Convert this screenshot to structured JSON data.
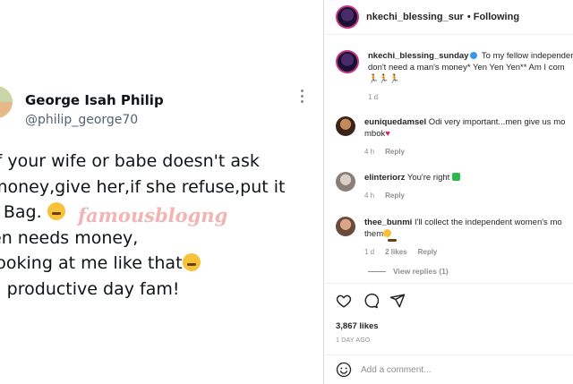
{
  "tweet": {
    "name": "George Isah Philip",
    "handle": "@philip_george70",
    "lines": [
      "If your wife or babe doesn't ask",
      "money,give her,if she refuse,put it",
      "r Bag.",
      "en needs money,",
      "looking at me like that",
      "a productive day fam!"
    ],
    "watermark": "famousblogng"
  },
  "header": {
    "username": "nkechi_blessing_sur",
    "follow_label": "• Following"
  },
  "caption": {
    "username": "nkechi_blessing_sunday",
    "text_1": " To my fellow independent",
    "text_2": "don't need a man's money* Yen Yen Yen** Am I com",
    "text_3": "🏃🏃🏃",
    "time": "1 d"
  },
  "comments": [
    {
      "username": "euniquedamsel",
      "text": " Odi very important...men give us mo",
      "text_2": "mbok",
      "time": "4 h",
      "reply": "Reply"
    },
    {
      "username": "elinteriorz",
      "text": " You're right ",
      "time": "4 h",
      "reply": "Reply"
    },
    {
      "username": "thee_bunmi",
      "text": " I'll collect the independent women's mo",
      "text_2": "them",
      "time": "1 d",
      "likes": "2 likes",
      "reply": "Reply"
    }
  ],
  "view_replies": "View replies (1)",
  "likes": "3,867 likes",
  "time_ago": "1 DAY AGO",
  "add_comment_placeholder": "Add a comment...",
  "colors": {
    "accent": "#3897f0",
    "verified": "#3897f0",
    "heart": "#e0245e"
  }
}
